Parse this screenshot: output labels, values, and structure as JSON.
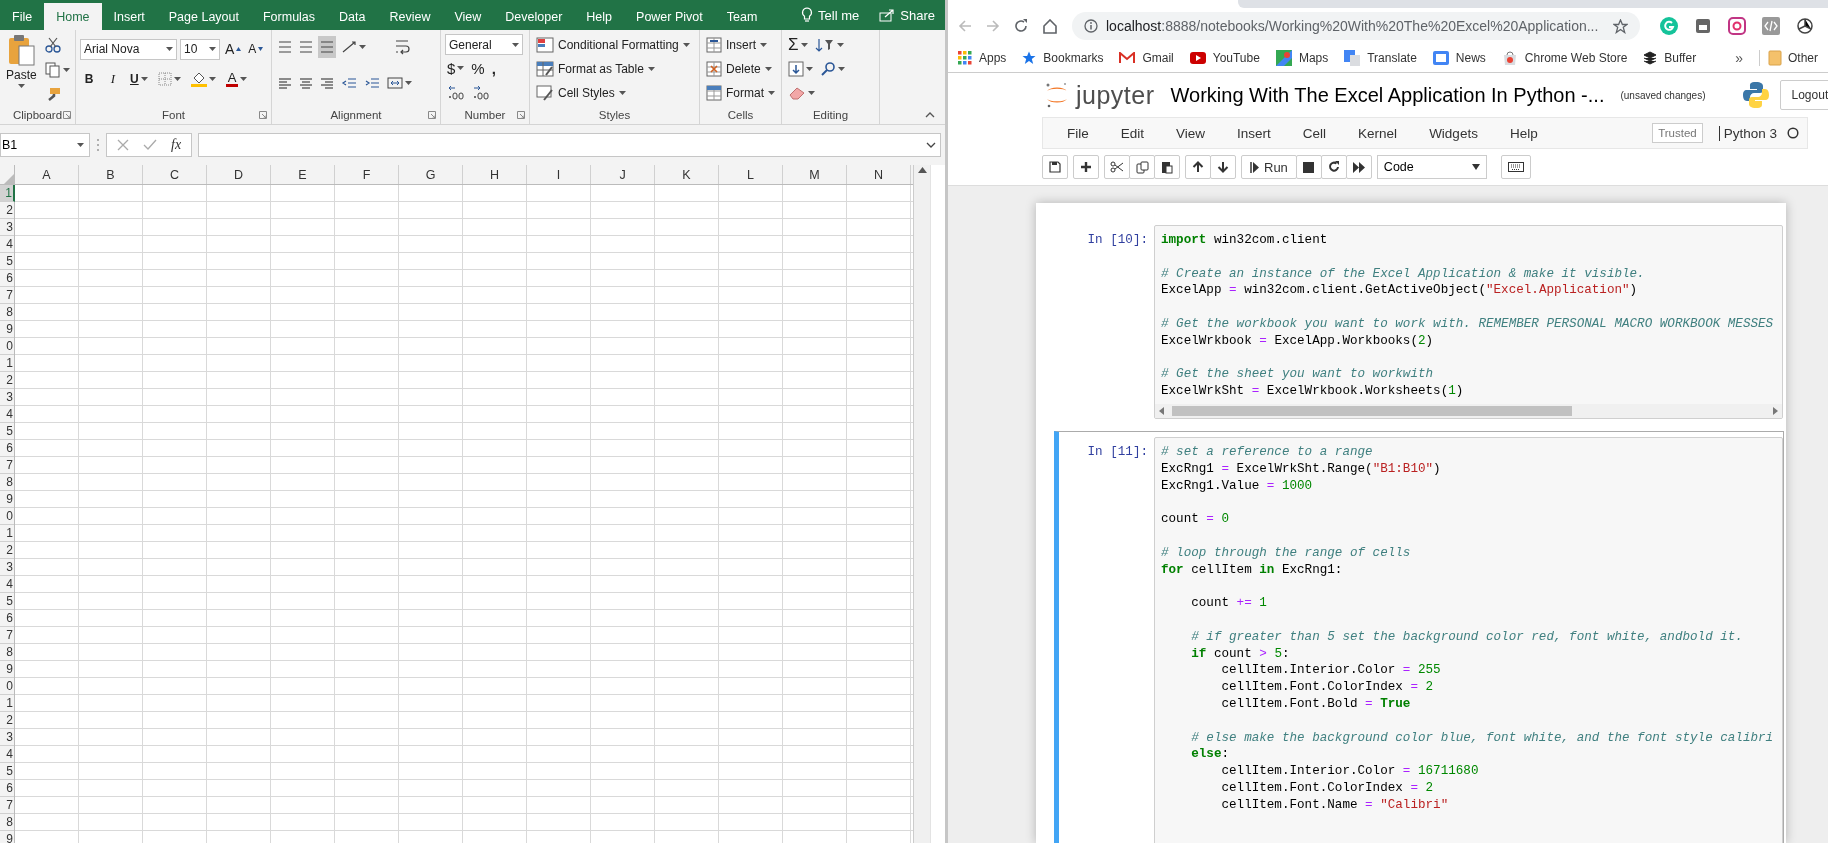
{
  "excel": {
    "tabs": [
      {
        "label": "File",
        "selected": false
      },
      {
        "label": "Home",
        "selected": true
      },
      {
        "label": "Insert",
        "selected": false
      },
      {
        "label": "Page Layout",
        "selected": false
      },
      {
        "label": "Formulas",
        "selected": false
      },
      {
        "label": "Data",
        "selected": false
      },
      {
        "label": "Review",
        "selected": false
      },
      {
        "label": "View",
        "selected": false
      },
      {
        "label": "Developer",
        "selected": false
      },
      {
        "label": "Help",
        "selected": false
      },
      {
        "label": "Power Pivot",
        "selected": false
      },
      {
        "label": "Team",
        "selected": false
      }
    ],
    "tell_me": "Tell me",
    "share": "Share",
    "ribbon_groups": [
      {
        "kind": "clipboard",
        "label": "Clipboard",
        "launcher": true,
        "paste": "Paste"
      },
      {
        "kind": "font",
        "label": "Font",
        "launcher": true,
        "font_name": "Arial Nova",
        "font_size": "10",
        "grow": "A",
        "shrink": "A",
        "bold": "B",
        "italic": "I",
        "underline": "U",
        "font_color": "A"
      },
      {
        "kind": "alignment",
        "label": "Alignment",
        "launcher": true,
        "vertical": [
          {
            "selected": false
          },
          {
            "selected": false
          },
          {
            "selected": true
          }
        ]
      },
      {
        "kind": "number",
        "label": "Number",
        "launcher": true,
        "format": "General",
        "currency": "$",
        "percent": "%",
        "comma": ","
      },
      {
        "kind": "styles",
        "label": "Styles",
        "launcher": false,
        "commands": [
          "Conditional Formatting",
          "Format as Table",
          "Cell Styles"
        ]
      },
      {
        "kind": "cells",
        "label": "Cells",
        "launcher": false,
        "commands": [
          "Insert",
          "Delete",
          "Format"
        ]
      },
      {
        "kind": "editing",
        "label": "Editing",
        "launcher": false,
        "sum": "Σ"
      }
    ],
    "name_box": "B1",
    "fx": "fx",
    "columns": [
      "A",
      "B",
      "C",
      "D",
      "E",
      "F",
      "G",
      "H",
      "I",
      "J",
      "K",
      "L",
      "M",
      "N"
    ],
    "rows": [
      {
        "label": "1",
        "selected": true
      },
      {
        "label": "2",
        "selected": false
      },
      {
        "label": "3",
        "selected": false
      },
      {
        "label": "4",
        "selected": false
      },
      {
        "label": "5",
        "selected": false
      },
      {
        "label": "6",
        "selected": false
      },
      {
        "label": "7",
        "selected": false
      },
      {
        "label": "8",
        "selected": false
      },
      {
        "label": "9",
        "selected": false
      },
      {
        "label": "0",
        "selected": false
      },
      {
        "label": "1",
        "selected": false
      },
      {
        "label": "2",
        "selected": false
      },
      {
        "label": "3",
        "selected": false
      },
      {
        "label": "4",
        "selected": false
      },
      {
        "label": "5",
        "selected": false
      },
      {
        "label": "6",
        "selected": false
      },
      {
        "label": "7",
        "selected": false
      },
      {
        "label": "8",
        "selected": false
      },
      {
        "label": "9",
        "selected": false
      },
      {
        "label": "0",
        "selected": false
      },
      {
        "label": "1",
        "selected": false
      },
      {
        "label": "2",
        "selected": false
      },
      {
        "label": "3",
        "selected": false
      },
      {
        "label": "4",
        "selected": false
      },
      {
        "label": "5",
        "selected": false
      },
      {
        "label": "6",
        "selected": false
      },
      {
        "label": "7",
        "selected": false
      },
      {
        "label": "8",
        "selected": false
      },
      {
        "label": "9",
        "selected": false
      },
      {
        "label": "0",
        "selected": false
      },
      {
        "label": "1",
        "selected": false
      },
      {
        "label": "2",
        "selected": false
      },
      {
        "label": "3",
        "selected": false
      },
      {
        "label": "4",
        "selected": false
      },
      {
        "label": "5",
        "selected": false
      },
      {
        "label": "6",
        "selected": false
      },
      {
        "label": "7",
        "selected": false
      },
      {
        "label": "8",
        "selected": false
      },
      {
        "label": "9",
        "selected": false
      }
    ]
  },
  "browser": {
    "url_host": "localhost",
    "url_path": ":8888/notebooks/Working%20With%20The%20Excel%20Application...",
    "bookmarks": [
      {
        "kind": "apps",
        "label": "Apps"
      },
      {
        "kind": "star",
        "label": "Bookmarks"
      },
      {
        "kind": "gmail",
        "label": "Gmail"
      },
      {
        "kind": "youtube",
        "label": "YouTube"
      },
      {
        "kind": "maps",
        "label": "Maps"
      },
      {
        "kind": "translate",
        "label": "Translate"
      },
      {
        "kind": "news",
        "label": "News"
      },
      {
        "kind": "store",
        "label": "Chrome Web Store"
      },
      {
        "kind": "buffer",
        "label": "Buffer"
      }
    ],
    "more": "»",
    "other": "Other"
  },
  "jupyter": {
    "logo": "jupyter",
    "title": "Working With The Excel Application In Python -...",
    "status": "(unsaved changes)",
    "logout": "Logout",
    "menu": [
      "File",
      "Edit",
      "View",
      "Insert",
      "Cell",
      "Kernel",
      "Widgets",
      "Help"
    ],
    "trusted": "Trusted",
    "kernel": "Python 3",
    "run": "Run",
    "cell_type": "Code",
    "cells": [
      {
        "prompt": "In [10]:",
        "selected": false,
        "blocks": [
          [
            [
              {
                "kind": "kw",
                "text": "import"
              },
              {
                "kind": "p",
                "text": " win32com.client"
              }
            ]
          ],
          [
            [
              {
                "kind": "cm",
                "text": "# Create an instance of the Excel Application & make it visible."
              }
            ],
            [
              {
                "kind": "p",
                "text": "ExcelApp"
              },
              {
                "kind": "op",
                "text": " = "
              },
              {
                "kind": "p",
                "text": "win32com.client.GetActiveObject("
              },
              {
                "kind": "str",
                "text": "\"Excel.Application\""
              },
              {
                "kind": "p",
                "text": ")"
              }
            ]
          ],
          [
            [
              {
                "kind": "cm",
                "text": "# Get the workbook you want to work with. REMEMBER PERSONAL MACRO WORKBOOK MESSES"
              }
            ],
            [
              {
                "kind": "p",
                "text": "ExcelWrkbook"
              },
              {
                "kind": "op",
                "text": " = "
              },
              {
                "kind": "p",
                "text": "ExcelApp.Workbooks("
              },
              {
                "kind": "num",
                "text": "2"
              },
              {
                "kind": "p",
                "text": ")"
              }
            ]
          ],
          [
            [
              {
                "kind": "cm",
                "text": "# Get the sheet you want to workwith"
              }
            ],
            [
              {
                "kind": "p",
                "text": "ExcelWrkSht"
              },
              {
                "kind": "op",
                "text": " = "
              },
              {
                "kind": "p",
                "text": "ExcelWrkbook.Worksheets("
              },
              {
                "kind": "num",
                "text": "1"
              },
              {
                "kind": "p",
                "text": ")"
              }
            ]
          ]
        ]
      },
      {
        "prompt": "In [11]:",
        "selected": true,
        "blocks": [
          [
            [
              {
                "kind": "cm",
                "text": "# set a reference to a range"
              }
            ],
            [
              {
                "kind": "p",
                "text": "ExcRng1"
              },
              {
                "kind": "op",
                "text": " = "
              },
              {
                "kind": "p",
                "text": "ExcelWrkSht.Range("
              },
              {
                "kind": "str",
                "text": "\"B1:B10\""
              },
              {
                "kind": "p",
                "text": ")"
              }
            ],
            [
              {
                "kind": "p",
                "text": "ExcRng1.Value"
              },
              {
                "kind": "op",
                "text": " = "
              },
              {
                "kind": "num",
                "text": "1000"
              }
            ]
          ],
          [
            [
              {
                "kind": "p",
                "text": "count"
              },
              {
                "kind": "op",
                "text": " = "
              },
              {
                "kind": "num",
                "text": "0"
              }
            ]
          ],
          [
            [
              {
                "kind": "cm",
                "text": "# loop through the range of cells"
              }
            ],
            [
              {
                "kind": "kw",
                "text": "for"
              },
              {
                "kind": "p",
                "text": " cellItem "
              },
              {
                "kind": "kw",
                "text": "in"
              },
              {
                "kind": "p",
                "text": " ExcRng1:"
              }
            ]
          ],
          [
            [
              {
                "kind": "p",
                "text": "    count"
              },
              {
                "kind": "op",
                "text": " += "
              },
              {
                "kind": "num",
                "text": "1"
              }
            ]
          ],
          [
            [
              {
                "kind": "cm",
                "text": "    # if greater than 5 set the background color red, font white, andbold it."
              }
            ],
            [
              {
                "kind": "kw",
                "text": "    if"
              },
              {
                "kind": "p",
                "text": " count"
              },
              {
                "kind": "op",
                "text": " > "
              },
              {
                "kind": "num",
                "text": "5"
              },
              {
                "kind": "p",
                "text": ":"
              }
            ],
            [
              {
                "kind": "p",
                "text": "        cellItem.Interior.Color"
              },
              {
                "kind": "op",
                "text": " = "
              },
              {
                "kind": "num",
                "text": "255"
              }
            ],
            [
              {
                "kind": "p",
                "text": "        cellItem.Font.ColorIndex"
              },
              {
                "kind": "op",
                "text": " = "
              },
              {
                "kind": "num",
                "text": "2"
              }
            ],
            [
              {
                "kind": "p",
                "text": "        cellItem.Font.Bold"
              },
              {
                "kind": "op",
                "text": " = "
              },
              {
                "kind": "kw",
                "text": "True"
              }
            ]
          ],
          [
            [
              {
                "kind": "cm",
                "text": "    # else make the background color blue, font white, and the font style calibri"
              }
            ],
            [
              {
                "kind": "kw",
                "text": "    else"
              },
              {
                "kind": "p",
                "text": ":"
              }
            ],
            [
              {
                "kind": "p",
                "text": "        cellItem.Interior.Color"
              },
              {
                "kind": "op",
                "text": " = "
              },
              {
                "kind": "num",
                "text": "16711680"
              }
            ],
            [
              {
                "kind": "p",
                "text": "        cellItem.Font.ColorIndex"
              },
              {
                "kind": "op",
                "text": " = "
              },
              {
                "kind": "num",
                "text": "2"
              }
            ],
            [
              {
                "kind": "p",
                "text": "        cellItem.Font.Name"
              },
              {
                "kind": "op",
                "text": " = "
              },
              {
                "kind": "str",
                "text": "\"Calibri\""
              }
            ]
          ]
        ]
      }
    ]
  }
}
